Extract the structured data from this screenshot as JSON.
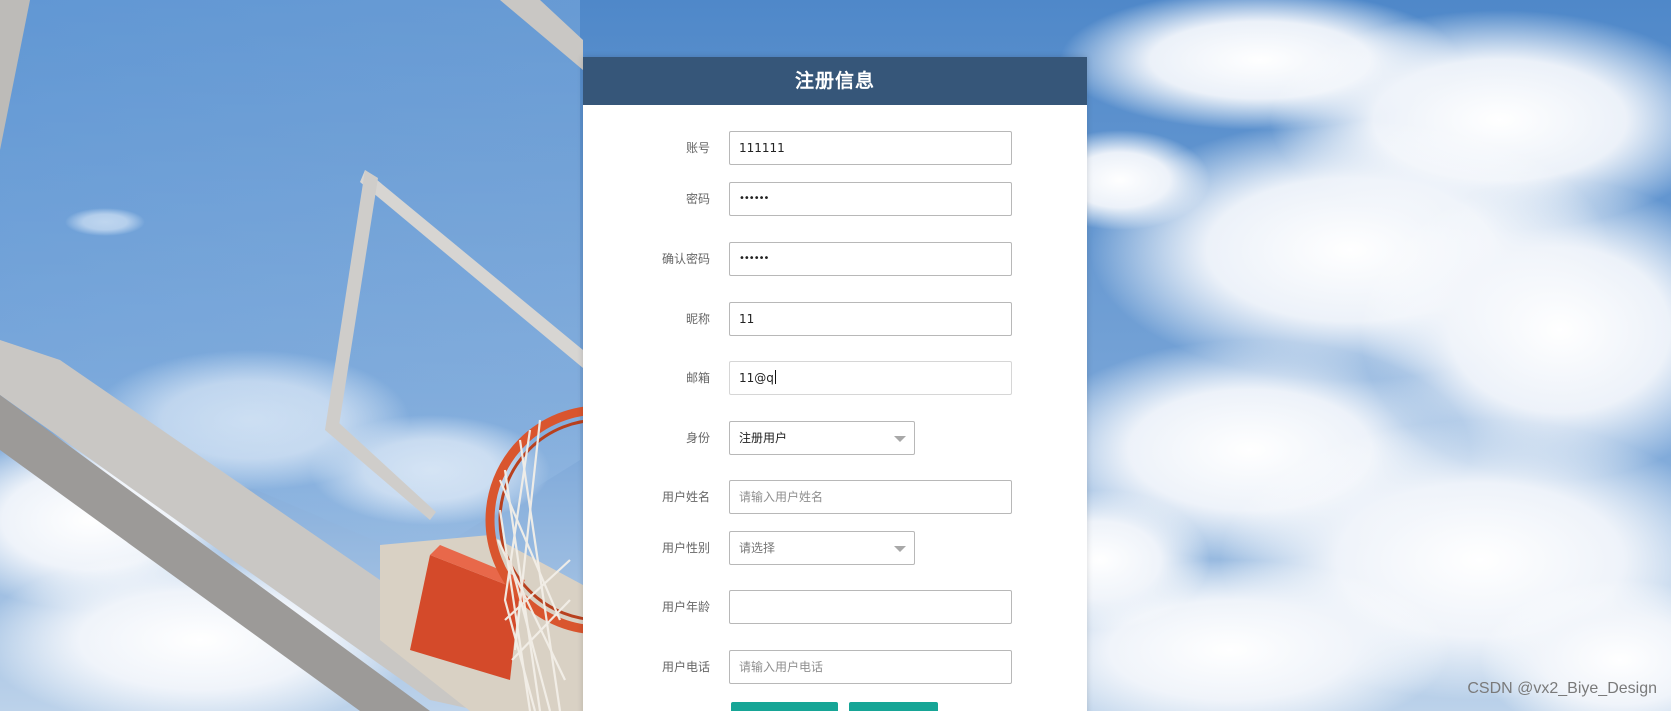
{
  "form": {
    "title": "注册信息",
    "fields": {
      "account": {
        "label": "账号",
        "value": "111111"
      },
      "password": {
        "label": "密码",
        "value": "••••••"
      },
      "confirm_password": {
        "label": "确认密码",
        "value": "••••••"
      },
      "nickname": {
        "label": "昵称",
        "value": "11"
      },
      "email": {
        "label": "邮箱",
        "value": "11@q"
      },
      "role": {
        "label": "身份",
        "value": "注册用户"
      },
      "user_name": {
        "label": "用户姓名",
        "placeholder": "请输入用户姓名"
      },
      "user_gender": {
        "label": "用户性别",
        "placeholder": "请选择"
      },
      "user_age": {
        "label": "用户年龄",
        "value": ""
      },
      "user_phone": {
        "label": "用户电话",
        "placeholder": "请输入用户电话"
      }
    },
    "colors": {
      "header": "#365679",
      "button": "#16a596"
    }
  },
  "watermark": "CSDN @vx2_Biye_Design"
}
